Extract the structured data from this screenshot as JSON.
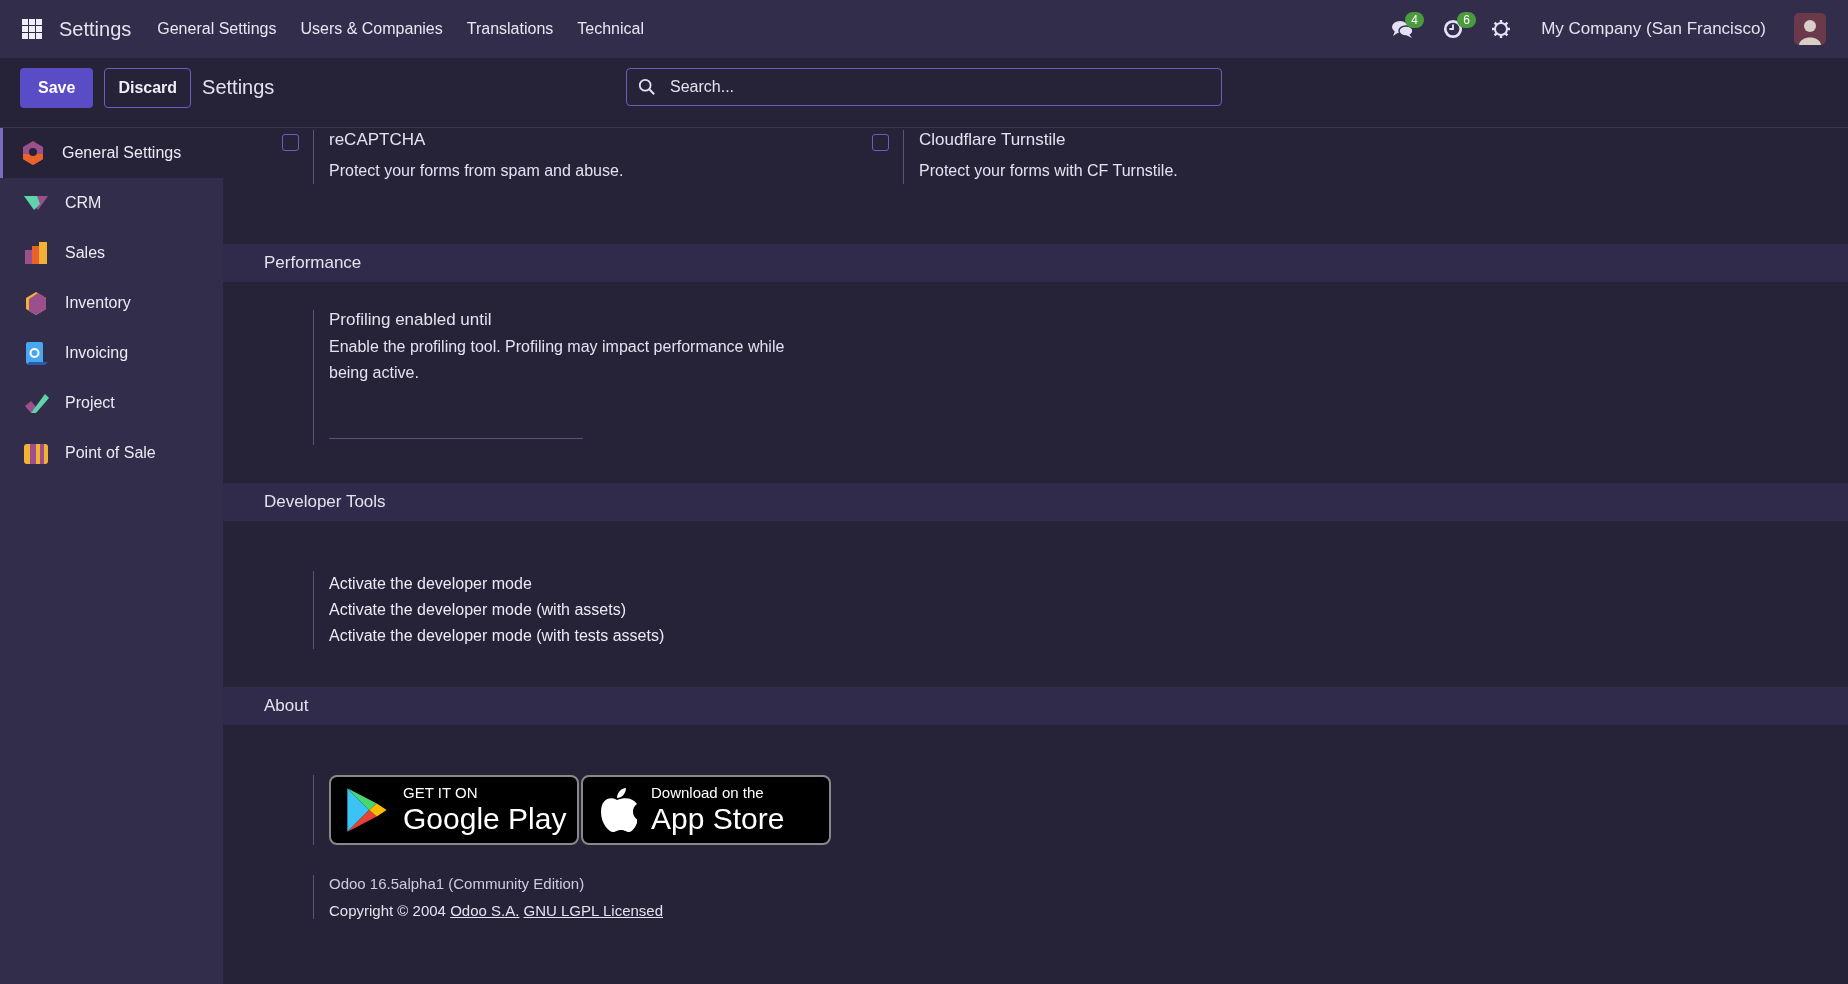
{
  "navbar": {
    "app_title": "Settings",
    "menu": [
      "General Settings",
      "Users & Companies",
      "Translations",
      "Technical"
    ],
    "messages_count": "4",
    "activities_count": "6",
    "company": "My Company (San Francisco)"
  },
  "control_panel": {
    "save": "Save",
    "discard": "Discard",
    "breadcrumb": "Settings",
    "search": {
      "placeholder": "Search..."
    }
  },
  "sidebar": {
    "items": [
      {
        "label": "General Settings",
        "selected": true
      },
      {
        "label": "CRM",
        "selected": false
      },
      {
        "label": "Sales",
        "selected": false
      },
      {
        "label": "Inventory",
        "selected": false
      },
      {
        "label": "Invoicing",
        "selected": false
      },
      {
        "label": "Project",
        "selected": false
      },
      {
        "label": "Point of Sale",
        "selected": false
      }
    ]
  },
  "top_settings": [
    {
      "title": "reCAPTCHA",
      "description": "Protect your forms from spam and abuse.",
      "checked": false
    },
    {
      "title": "Cloudflare Turnstile",
      "description": "Protect your forms with CF Turnstile.",
      "checked": false
    }
  ],
  "performance": {
    "heading": "Performance",
    "title": "Profiling enabled until",
    "description": "Enable the profiling tool. Profiling may impact performance while being active."
  },
  "developer_tools": {
    "heading": "Developer Tools",
    "links": [
      "Activate the developer mode",
      "Activate the developer mode (with assets)",
      "Activate the developer mode (with tests assets)"
    ]
  },
  "about": {
    "heading": "About",
    "google_play": {
      "small": "GET IT ON",
      "large": "Google Play"
    },
    "app_store": {
      "small": "Download on the",
      "large": "App Store"
    },
    "version": "Odoo 16.5alpha1 (Community Edition)",
    "copyright": "Copyright © 2004",
    "links": [
      "Odoo S.A.",
      "GNU LGPL Licensed"
    ]
  }
}
